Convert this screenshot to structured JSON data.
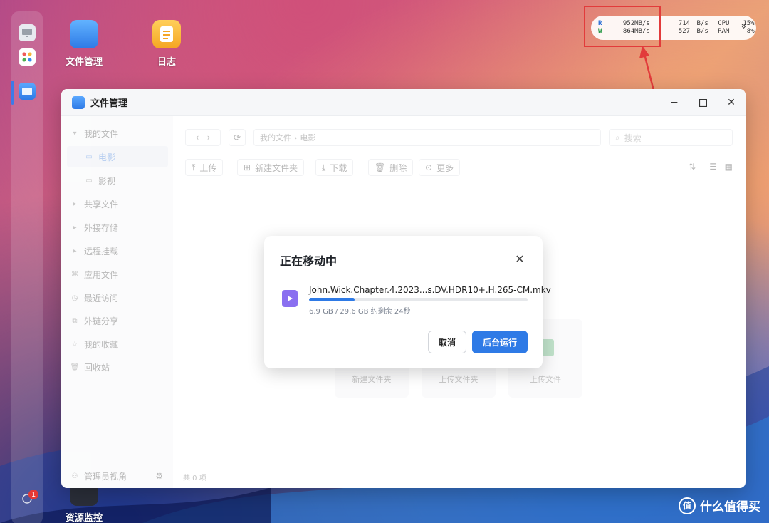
{
  "desktop": {
    "icons": [
      {
        "label": "文件管理"
      },
      {
        "label": "日志"
      },
      {
        "label": "资源监控"
      }
    ]
  },
  "dock": {
    "badge_count": "1"
  },
  "monitor": {
    "read_label": "R",
    "write_label": "W",
    "read_speed": "952MB/s",
    "write_speed": "864MB/s",
    "net_up": "714",
    "net_down": "527",
    "net_unit": "B/s",
    "cpu_label": "CPU",
    "ram_label": "RAM",
    "cpu_value": "15%",
    "ram_value": "8%",
    "expand_glyph": "»"
  },
  "window": {
    "title": "文件管理",
    "sidebar": {
      "items": [
        {
          "label": "我的文件"
        },
        {
          "label": "电影"
        },
        {
          "label": "影视"
        },
        {
          "label": "共享文件"
        },
        {
          "label": "外接存储"
        },
        {
          "label": "远程挂载"
        },
        {
          "label": "应用文件"
        },
        {
          "label": "最近访问"
        },
        {
          "label": "外链分享"
        },
        {
          "label": "我的收藏"
        },
        {
          "label": "回收站"
        }
      ],
      "footer_label": "管理员视角"
    },
    "breadcrumb": {
      "root": "我的文件",
      "separator": "›",
      "current": "电影"
    },
    "search_placeholder": "搜索",
    "toolbar": {
      "upload": "上传",
      "new_folder": "新建文件夹",
      "download": "下载",
      "delete": "删除",
      "more": "更多"
    },
    "empty_actions": [
      {
        "label": "新建文件夹"
      },
      {
        "label": "上传文件夹"
      },
      {
        "label": "上传文件"
      }
    ],
    "status_bar": "共 0 项"
  },
  "dialog": {
    "title": "正在移动中",
    "file_name": "John.Wick.Chapter.4.2023...s.DV.HDR10+.H.265-CM.mkv",
    "progress_text": "6.9 GB / 29.6 GB 约剩余 24秒",
    "progress_fraction": 0.21,
    "cancel_label": "取消",
    "background_label": "后台运行"
  },
  "watermark": {
    "seal": "值",
    "text": "什么值得买"
  },
  "colors": {
    "accent": "#2e7ae6",
    "annotation": "#e23b3b"
  }
}
